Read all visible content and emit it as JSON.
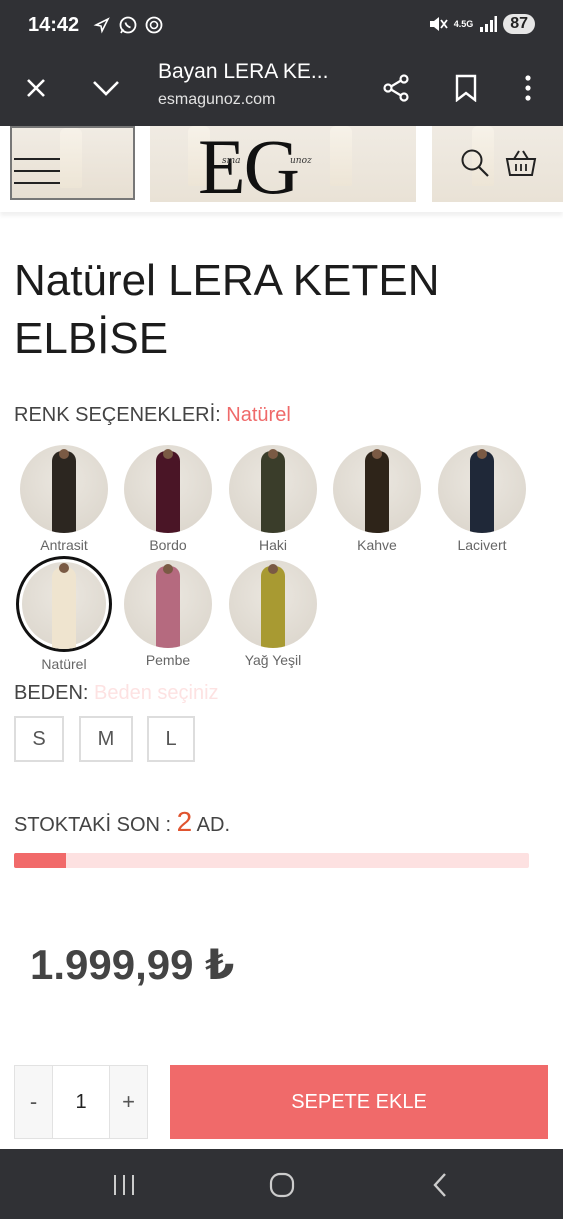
{
  "status_bar": {
    "time": "14:42",
    "network": "4.5G",
    "battery": "87"
  },
  "browser": {
    "page_title": "Bayan LERA KE...",
    "url": "esmagunoz.com"
  },
  "site": {
    "logo_text": "EG",
    "logo_small_left": "sma",
    "logo_small_right": "unoz"
  },
  "product": {
    "title_line1": "Natürel LERA KETEN",
    "title_line2": "ELBİSE",
    "color_label": "RENK SEÇENEKLERİ:",
    "selected_color": "Natürel",
    "colors": [
      {
        "name": "Antrasit",
        "swatch": "#2c2620"
      },
      {
        "name": "Bordo",
        "swatch": "#4a1526"
      },
      {
        "name": "Haki",
        "swatch": "#3a3d2a"
      },
      {
        "name": "Kahve",
        "swatch": "#2e2419"
      },
      {
        "name": "Lacivert",
        "swatch": "#1f2838"
      },
      {
        "name": "Natürel",
        "swatch": "#efe4cf"
      },
      {
        "name": "Pembe",
        "swatch": "#b56a7f"
      },
      {
        "name": "Yağ Yeşil",
        "swatch": "#a89a32"
      }
    ],
    "size_label": "BEDEN:",
    "size_hint": "Beden seçiniz",
    "sizes": [
      "S",
      "M",
      "L"
    ],
    "stock_label": "STOKTAKİ SON :",
    "stock_count": "2",
    "stock_unit": "AD.",
    "stock_level_percent": 10,
    "price": "1.999,99 ₺",
    "quantity": "1",
    "qty_minus": "-",
    "qty_plus": "+",
    "add_to_cart": "SEPETE EKLE"
  },
  "colors": {
    "accent": "#f06a6a",
    "stock_number": "#e0542f",
    "system_bar": "#303135"
  }
}
